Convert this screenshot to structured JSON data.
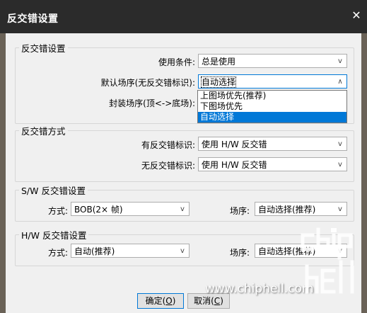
{
  "window": {
    "title": "反交错设置",
    "close_glyph": "✕"
  },
  "deinterlace": {
    "legend": "反交错设置",
    "use_condition_label": "使用条件:",
    "use_condition_value": "总是使用",
    "default_field_order_label": "默认场序(无反交错标识):",
    "default_field_order_value": "自动选择",
    "encapsulated_field_order_label": "封装场序(顶<->底场):",
    "dropdown_options": [
      "上图场优先(推荐)",
      "下图场优先",
      "自动选择"
    ]
  },
  "method": {
    "legend": "反交错方式",
    "with_flag_label": "有反交错标识:",
    "with_flag_value": "使用 H/W 反交错",
    "without_flag_label": "无反交错标识:",
    "without_flag_value": "使用 H/W 反交错"
  },
  "sw": {
    "legend": "S/W 反交错设置",
    "mode_label": "方式:",
    "mode_value": "BOB(2× 帧)",
    "field_order_label": "场序:",
    "field_order_value": "自动选择(推荐)"
  },
  "hw": {
    "legend": "H/W 反交错设置",
    "mode_label": "方式:",
    "mode_value": "自动(推荐)",
    "field_order_label": "场序:",
    "field_order_value": "自动选择(推荐)"
  },
  "buttons": {
    "ok_text": "确定(",
    "ok_key": "O",
    "ok_close": ")",
    "cancel_text": "取消(",
    "cancel_key": "C",
    "cancel_close": ")"
  },
  "watermark": {
    "site": "www.chiphell.com",
    "logo_text": "chip hell"
  },
  "icons": {
    "arrow_down": "v",
    "arrow_up": "∧"
  }
}
